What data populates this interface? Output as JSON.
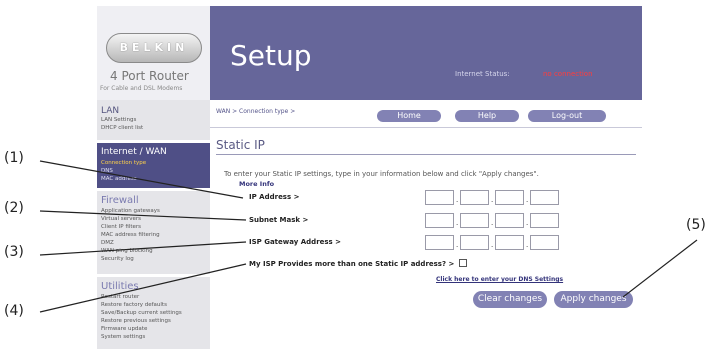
{
  "logo": {
    "brand": "BELKIN",
    "product": "4 Port Router",
    "subtitle": "For Cable and DSL Modems"
  },
  "header": {
    "title": "Setup",
    "status_label": "Internet Status:",
    "status_value": "no connection"
  },
  "sidebar": {
    "lan": {
      "title": "LAN",
      "items": [
        "LAN Settings",
        "DHCP client list"
      ]
    },
    "wan": {
      "title": "Internet / WAN",
      "items": [
        "Connection type",
        "DNS",
        "MAC address"
      ]
    },
    "firewall": {
      "title": "Firewall",
      "items": [
        "Application gateways",
        "Virtual servers",
        "Client IP filters",
        "MAC address filtering",
        "DMZ",
        "WAN ping blocking",
        "Security log"
      ]
    },
    "utilities": {
      "title": "Utilities",
      "items": [
        "Restart router",
        "Restore factory defaults",
        "Save/Backup current settings",
        "Restore previous settings",
        "Firmware update",
        "System settings"
      ]
    }
  },
  "nav": {
    "breadcrumb": "WAN > Connection type >",
    "home": "Home",
    "help": "Help",
    "logout": "Log-out"
  },
  "form": {
    "title": "Static IP",
    "intro": "To enter your Static IP settings, type in your information below and click \"Apply changes\".",
    "more_info": "More Info",
    "ip_label": "IP Address >",
    "mask_label": "Subnet Mask >",
    "gateway_label": "ISP Gateway Address >",
    "multi_label": "My ISP Provides more than one Static IP address? >",
    "multi_checked": false,
    "ip": [
      "",
      "",
      "",
      ""
    ],
    "mask": [
      "",
      "",
      "",
      ""
    ],
    "gateway": [
      "",
      "",
      "",
      ""
    ],
    "dns_link": "Click here to enter your DNS Settings",
    "clear": "Clear changes",
    "apply": "Apply changes"
  },
  "callouts": [
    "(1)",
    "(2)",
    "(3)",
    "(4)",
    "(5)"
  ],
  "colors": {
    "header": "#66669a",
    "button": "#8282b4",
    "status_alert": "#ff3c3c",
    "sidebar_active": "#4f4f86"
  }
}
